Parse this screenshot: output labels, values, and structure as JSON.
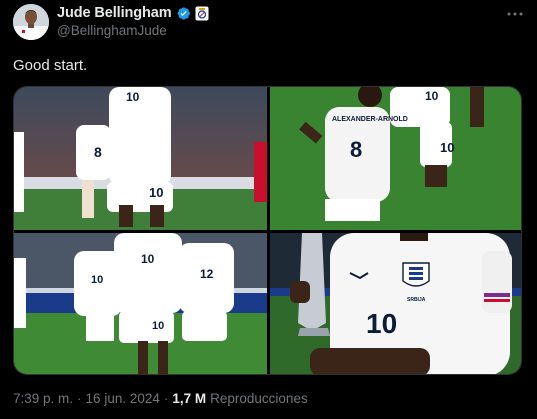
{
  "author": {
    "display_name": "Jude Bellingham",
    "handle": "@BellinghamJude",
    "verified_color": "#1d9bf0"
  },
  "tweet": {
    "text": "Good start."
  },
  "media": {
    "photos": [
      {
        "shirt_numbers": [
          "10",
          "8",
          "10"
        ]
      },
      {
        "shirt_numbers": [
          "8",
          "10",
          "10"
        ],
        "shirt_name": "ALEXANDER-ARNOLD"
      },
      {
        "shirt_numbers": [
          "10",
          "12",
          "10",
          "10"
        ]
      },
      {
        "shirt_numbers": [
          "10"
        ],
        "shirt_text": "SRBIJA"
      }
    ]
  },
  "meta": {
    "time": "7:39 p. m.",
    "separator": "·",
    "date": "16 jun. 2024",
    "views_count": "1,7 M",
    "views_label": "Reproducciones"
  },
  "icons": {
    "verified": "verified-badge-icon",
    "affiliate": "real-madrid-crest-icon",
    "more": "more-options-icon"
  }
}
